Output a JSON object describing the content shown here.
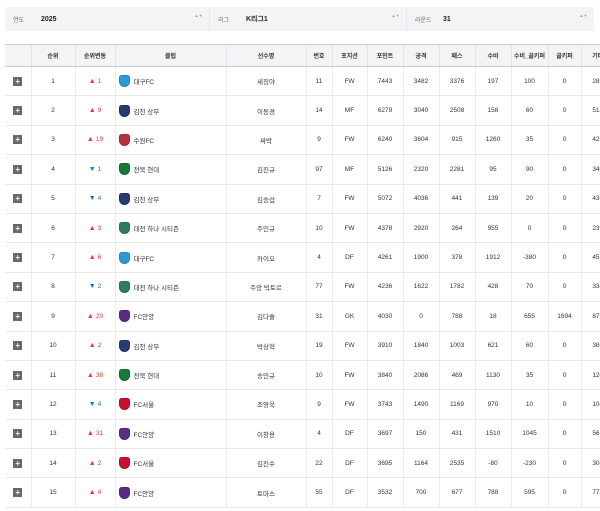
{
  "filters": [
    {
      "label": "연도",
      "value": "2025"
    },
    {
      "label": "리그",
      "value": "K리그1"
    },
    {
      "label": "라운드",
      "value": "31"
    }
  ],
  "columns": [
    "",
    "순위",
    "순위변동",
    "클럽",
    "선수명",
    "번호",
    "포지션",
    "포인트",
    "공격",
    "패스",
    "수비",
    "수비_골키퍼",
    "골키퍼",
    "기타"
  ],
  "colors": {
    "up": "#e03b3b",
    "down": "#1f6fd6"
  },
  "rows": [
    {
      "rank": "1",
      "dir": "up",
      "change": "1",
      "club": "대구FC",
      "club_color": "#2d9ad8",
      "player": "세징야",
      "number": "11",
      "position": "FW",
      "points": "7443",
      "attack": "3482",
      "pass": "3376",
      "defense": "197",
      "def_gk": "100",
      "gk": "0",
      "etc": "288"
    },
    {
      "rank": "2",
      "dir": "up",
      "change": "9",
      "club": "김천 상무",
      "club_color": "#2a3a73",
      "player": "이동경",
      "number": "14",
      "position": "MF",
      "points": "6279",
      "attack": "3040",
      "pass": "2508",
      "defense": "158",
      "def_gk": "60",
      "gk": "0",
      "etc": "513"
    },
    {
      "rank": "3",
      "dir": "up",
      "change": "19",
      "club": "수원FC",
      "club_color": "#b8323d",
      "player": "싸박",
      "number": "9",
      "position": "FW",
      "points": "6240",
      "attack": "3604",
      "pass": "915",
      "defense": "1260",
      "def_gk": "35",
      "gk": "0",
      "etc": "426"
    },
    {
      "rank": "4",
      "dir": "down",
      "change": "1",
      "club": "전북 현대",
      "club_color": "#157a3a",
      "player": "김진규",
      "number": "97",
      "position": "MF",
      "points": "5126",
      "attack": "2320",
      "pass": "2281",
      "defense": "95",
      "def_gk": "90",
      "gk": "0",
      "etc": "340"
    },
    {
      "rank": "5",
      "dir": "down",
      "change": "4",
      "club": "김천 상무",
      "club_color": "#2a3a73",
      "player": "김승섭",
      "number": "7",
      "position": "FW",
      "points": "5072",
      "attack": "4036",
      "pass": "441",
      "defense": "139",
      "def_gk": "20",
      "gk": "0",
      "etc": "436"
    },
    {
      "rank": "6",
      "dir": "up",
      "change": "3",
      "club": "대전 하나 시티즌",
      "club_color": "#2e7d5b",
      "player": "주민규",
      "number": "10",
      "position": "FW",
      "points": "4378",
      "attack": "2920",
      "pass": "264",
      "defense": "955",
      "def_gk": "0",
      "gk": "0",
      "etc": "239"
    },
    {
      "rank": "7",
      "dir": "up",
      "change": "6",
      "club": "대구FC",
      "club_color": "#2d9ad8",
      "player": "카이오",
      "number": "4",
      "position": "DF",
      "points": "4261",
      "attack": "1900",
      "pass": "378",
      "defense": "1912",
      "def_gk": "-380",
      "gk": "0",
      "etc": "451"
    },
    {
      "rank": "8",
      "dir": "down",
      "change": "2",
      "club": "대전 하나 시티즌",
      "club_color": "#2e7d5b",
      "player": "주앙 빅토르",
      "number": "77",
      "position": "FW",
      "points": "4236",
      "attack": "1622",
      "pass": "1782",
      "defense": "428",
      "def_gk": "70",
      "gk": "0",
      "etc": "334"
    },
    {
      "rank": "9",
      "dir": "up",
      "change": "20",
      "club": "FC안양",
      "club_color": "#5b2c86",
      "player": "김다솔",
      "number": "31",
      "position": "GK",
      "points": "4030",
      "attack": "0",
      "pass": "788",
      "defense": "18",
      "def_gk": "655",
      "gk": "1694",
      "etc": "875"
    },
    {
      "rank": "10",
      "dir": "up",
      "change": "2",
      "club": "김천 상무",
      "club_color": "#2a3a73",
      "player": "박상혁",
      "number": "19",
      "position": "FW",
      "points": "3910",
      "attack": "1840",
      "pass": "1003",
      "defense": "621",
      "def_gk": "60",
      "gk": "0",
      "etc": "386"
    },
    {
      "rank": "11",
      "dir": "up",
      "change": "38",
      "club": "전북 현대",
      "club_color": "#157a3a",
      "player": "송민규",
      "number": "10",
      "position": "FW",
      "points": "3840",
      "attack": "2086",
      "pass": "469",
      "defense": "1130",
      "def_gk": "35",
      "gk": "0",
      "etc": "120"
    },
    {
      "rank": "12",
      "dir": "down",
      "change": "4",
      "club": "FC서울",
      "club_color": "#c8102e",
      "player": "조영욱",
      "number": "9",
      "position": "FW",
      "points": "3743",
      "attack": "1490",
      "pass": "1169",
      "defense": "970",
      "def_gk": "10",
      "gk": "0",
      "etc": "104"
    },
    {
      "rank": "13",
      "dir": "up",
      "change": "31",
      "club": "FC안양",
      "club_color": "#5b2c86",
      "player": "이창용",
      "number": "4",
      "position": "DF",
      "points": "3697",
      "attack": "150",
      "pass": "431",
      "defense": "1510",
      "def_gk": "1045",
      "gk": "0",
      "etc": "561"
    },
    {
      "rank": "14",
      "dir": "up",
      "change": "2",
      "club": "FC서울",
      "club_color": "#c8102e",
      "player": "김진수",
      "number": "22",
      "position": "DF",
      "points": "3695",
      "attack": "1164",
      "pass": "2535",
      "defense": "-80",
      "def_gk": "-230",
      "gk": "0",
      "etc": "306"
    },
    {
      "rank": "15",
      "dir": "up",
      "change": "4",
      "club": "FC안양",
      "club_color": "#5b2c86",
      "player": "토마스",
      "number": "55",
      "position": "DF",
      "points": "3532",
      "attack": "700",
      "pass": "677",
      "defense": "788",
      "def_gk": "595",
      "gk": "0",
      "etc": "772"
    }
  ]
}
